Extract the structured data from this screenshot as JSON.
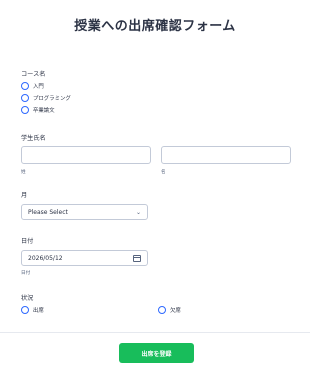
{
  "form": {
    "title": "授業への出席確認フォーム",
    "course": {
      "label": "コース名",
      "options": [
        "入門",
        "プログラミング",
        "卒業論文"
      ]
    },
    "student_name": {
      "label": "学生氏名",
      "first_sublabel": "姓",
      "last_sublabel": "名",
      "first_value": "",
      "last_value": ""
    },
    "month": {
      "label": "月",
      "selected": "Please Select"
    },
    "date": {
      "label": "日付",
      "value": "2026/05/12",
      "sublabel": "日付"
    },
    "status": {
      "label": "状況",
      "options": [
        "出席",
        "欠席"
      ]
    },
    "submit_label": "出席を登録"
  },
  "colors": {
    "accent": "#2e69ff",
    "submit": "#18bd5b",
    "text": "#2c3345",
    "border": "#c3cad8"
  },
  "icons": {
    "select": "chevron-down-icon",
    "date": "calendar-icon"
  }
}
